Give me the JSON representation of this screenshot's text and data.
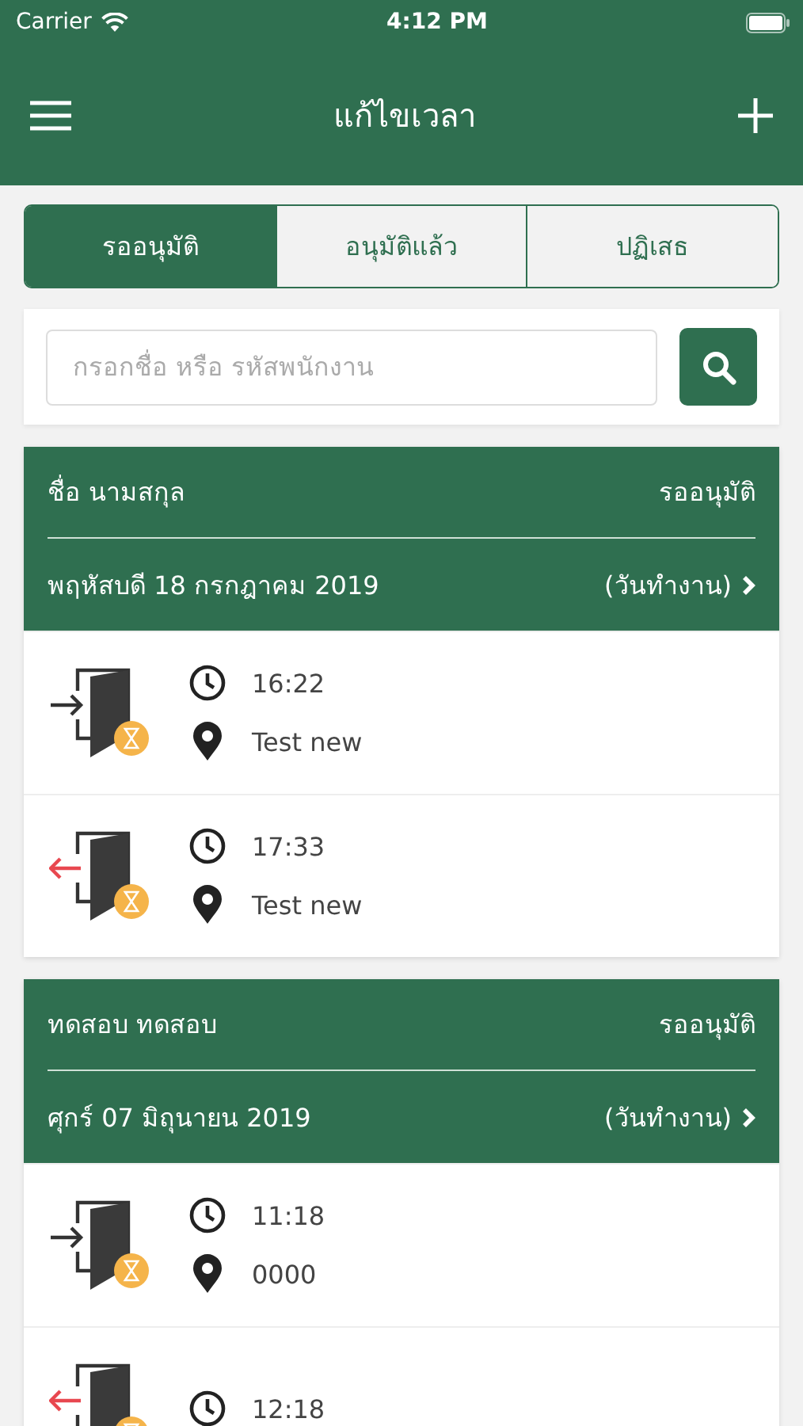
{
  "status_bar": {
    "carrier": "Carrier",
    "time": "4:12 PM"
  },
  "nav": {
    "title": "แก้ไขเวลา"
  },
  "tabs": [
    {
      "label": "รออนุมัติ",
      "selected": true
    },
    {
      "label": "อนุมัติแล้ว",
      "selected": false
    },
    {
      "label": "ปฏิเสธ",
      "selected": false
    }
  ],
  "search": {
    "placeholder": "กรอกชื่อ หรือ รหัสพนักงาน"
  },
  "requests": [
    {
      "name": "ชื่อ นามสกุล",
      "status": "รออนุมัติ",
      "date": "พฤหัสบดี 18 กรกฎาคม 2019",
      "day_type": "(วันทำงาน)",
      "entries": [
        {
          "kind": "in",
          "time": "16:22",
          "place": "Test new"
        },
        {
          "kind": "out",
          "time": "17:33",
          "place": "Test new"
        }
      ]
    },
    {
      "name": "ทดสอบ ทดสอบ",
      "status": "รออนุมัติ",
      "date": "ศุกร์ 07 มิถุนายน 2019",
      "day_type": "(วันทำงาน)",
      "entries": [
        {
          "kind": "in",
          "time": "11:18",
          "place": "0000"
        },
        {
          "kind": "out",
          "time": "12:18"
        }
      ]
    }
  ]
}
